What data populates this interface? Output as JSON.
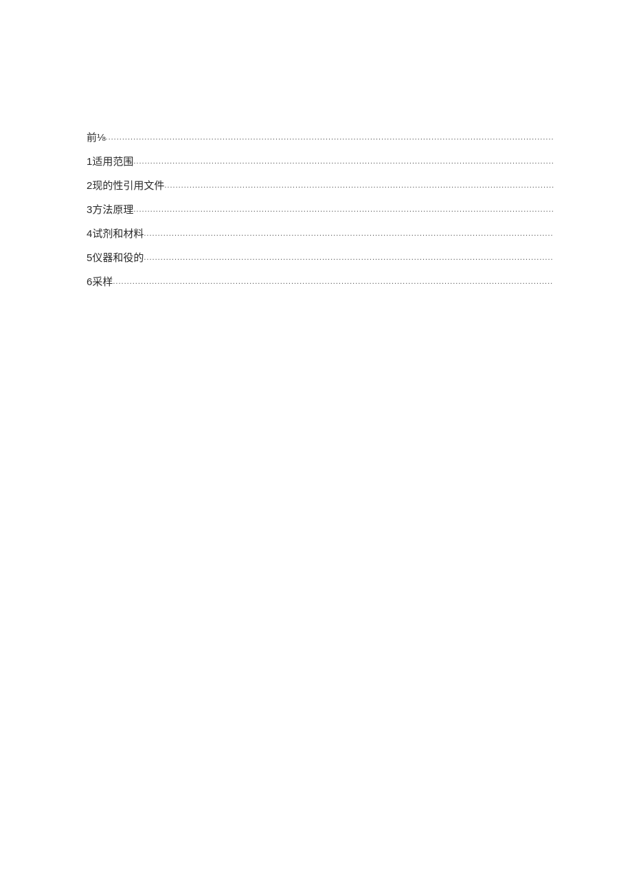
{
  "toc": {
    "entries": [
      {
        "label": "前⅛"
      },
      {
        "label": "1适用范围"
      },
      {
        "label": "2现的性引用文件"
      },
      {
        "label": "3方法原理"
      },
      {
        "label": "4试剂和材料"
      },
      {
        "label": "5仪器和役的"
      },
      {
        "label": "6采样"
      }
    ]
  }
}
